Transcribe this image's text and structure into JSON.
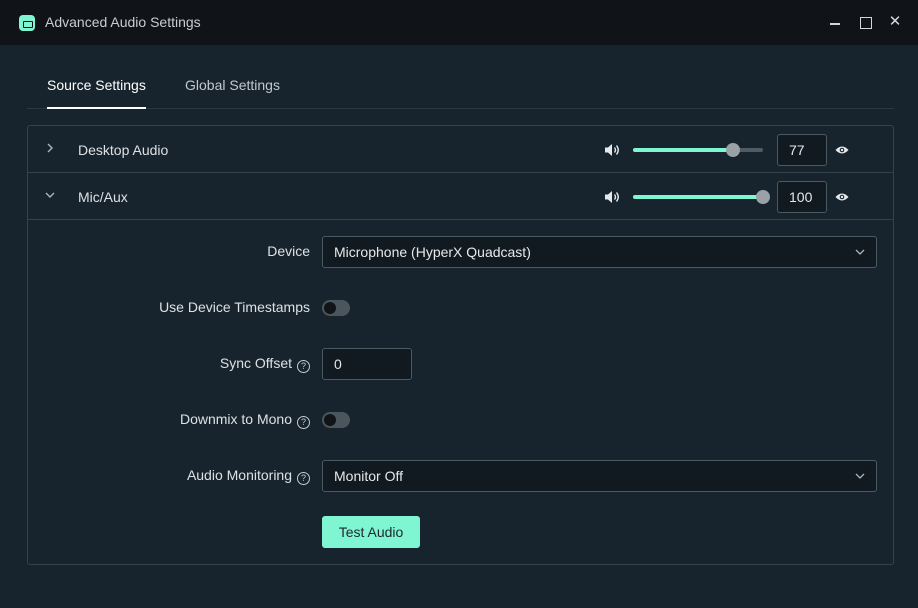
{
  "window": {
    "title": "Advanced Audio Settings",
    "close_glyph": "✕"
  },
  "tabs": [
    {
      "label": "Source Settings",
      "active": true
    },
    {
      "label": "Global Settings",
      "active": false
    }
  ],
  "sources": [
    {
      "name": "Desktop Audio",
      "expanded": false,
      "volume": "77",
      "volume_fraction": 0.77
    },
    {
      "name": "Mic/Aux",
      "expanded": true,
      "volume": "100",
      "volume_fraction": 1.0
    }
  ],
  "mic_settings": {
    "device_label": "Device",
    "device_value": "Microphone (HyperX Quadcast)",
    "timestamps_label": "Use Device Timestamps",
    "timestamps_on": false,
    "sync_offset_label": "Sync Offset",
    "sync_offset_value": "0",
    "downmix_label": "Downmix to Mono",
    "downmix_on": false,
    "monitoring_label": "Audio Monitoring",
    "monitoring_value": "Monitor Off",
    "help_glyph": "?",
    "test_button": "Test Audio"
  },
  "colors": {
    "accent": "#80f5d2",
    "background": "#17242d",
    "titlebar": "#101317"
  }
}
